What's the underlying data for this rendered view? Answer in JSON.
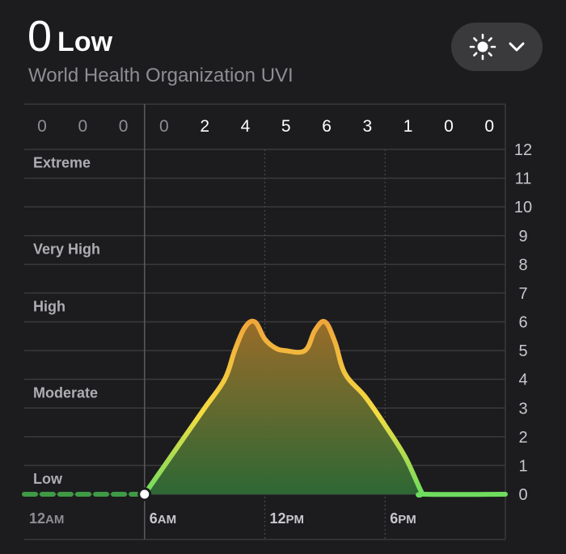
{
  "header": {
    "current_value": "0",
    "current_category": "Low",
    "subtitle": "World Health Organization UVI"
  },
  "selector": {
    "icon": "sun-icon",
    "chevron": "chevron-down-icon"
  },
  "colors": {
    "background": "#1c1c1e",
    "grid": "#3a3a3c",
    "line_low": "#6edc5f",
    "line_moderate": "#f4dc41",
    "line_high": "#f0a33a",
    "fill_top": "#a0702a",
    "fill_bottom": "#2e6b35",
    "muted_text": "#8e8e93",
    "past_line": "#3f9a45"
  },
  "chart_data": {
    "type": "area",
    "title": "",
    "ylim": [
      0,
      12
    ],
    "y_ticks": [
      "0",
      "1",
      "2",
      "3",
      "4",
      "5",
      "6",
      "7",
      "8",
      "9",
      "10",
      "11",
      "12"
    ],
    "xlim": [
      0,
      24
    ],
    "x_ticks": [
      {
        "x": 0,
        "label": "12",
        "suffix": "AM"
      },
      {
        "x": 6,
        "label": "6",
        "suffix": "AM"
      },
      {
        "x": 12,
        "label": "12",
        "suffix": "PM"
      },
      {
        "x": 18,
        "label": "6",
        "suffix": "PM"
      }
    ],
    "current_hour": 6,
    "hourly_max_labels": [
      "0",
      "0",
      "0",
      "0",
      "2",
      "4",
      "5",
      "6",
      "3",
      "1",
      "0",
      "0"
    ],
    "hourly_max_past_count": 4,
    "categories": [
      {
        "name": "Extreme",
        "y": 11
      },
      {
        "name": "Very High",
        "y": 8
      },
      {
        "name": "High",
        "y": 6
      },
      {
        "name": "Moderate",
        "y": 3
      },
      {
        "name": "Low",
        "y": 0
      }
    ],
    "grid": true,
    "series": [
      {
        "points": [
          [
            0,
            0
          ],
          [
            6,
            0
          ],
          [
            7,
            1
          ],
          [
            8,
            2
          ],
          [
            9,
            3
          ],
          [
            10,
            4
          ],
          [
            10.5,
            5
          ],
          [
            11,
            5.8
          ],
          [
            11.5,
            6
          ],
          [
            12,
            5.4
          ],
          [
            12.5,
            5.1
          ],
          [
            13,
            5
          ],
          [
            14,
            5
          ],
          [
            14.5,
            5.7
          ],
          [
            15,
            6
          ],
          [
            15.5,
            5.3
          ],
          [
            16,
            4.2
          ],
          [
            17,
            3.4
          ],
          [
            18,
            2.4
          ],
          [
            19,
            1.3
          ],
          [
            19.8,
            0.1
          ],
          [
            20,
            0
          ],
          [
            24,
            0
          ]
        ]
      }
    ]
  }
}
